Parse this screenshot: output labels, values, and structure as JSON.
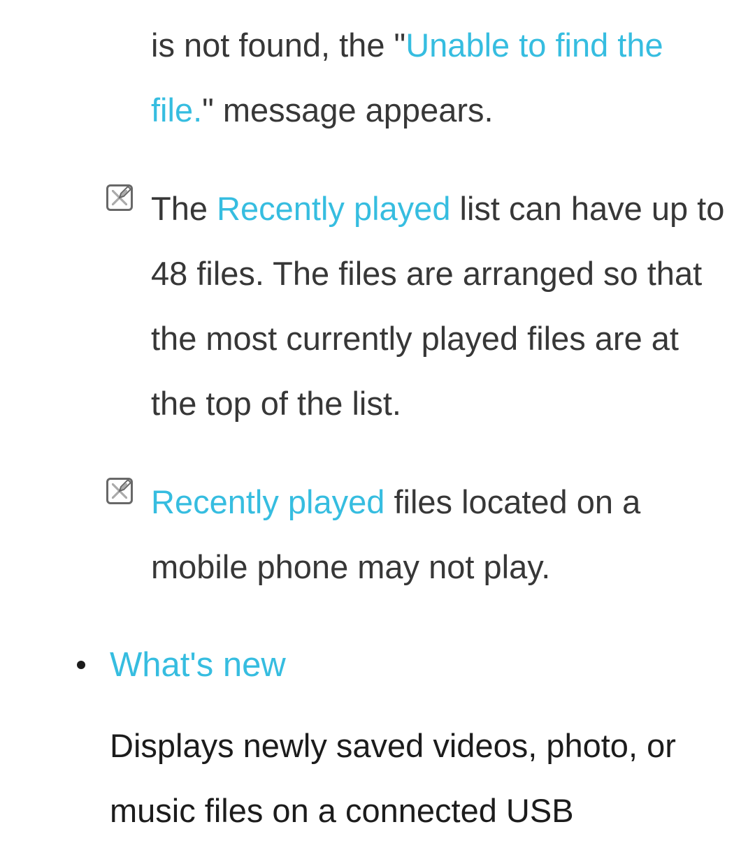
{
  "notes": [
    {
      "pre": "is not found, the \"",
      "highlight": "Unable to find the file.",
      "post": "\" message appears."
    },
    {
      "pre": "The ",
      "highlight": "Recently played",
      "post": " list can have up to 48 files. The files are arranged so that the most currently played files are at the top of the list."
    },
    {
      "pre": "",
      "highlight": "Recently played",
      "post": " files located on a mobile phone may not play."
    }
  ],
  "section": {
    "heading": "What's new",
    "body": "Displays newly saved videos, photo, or music files on a connected USB"
  }
}
